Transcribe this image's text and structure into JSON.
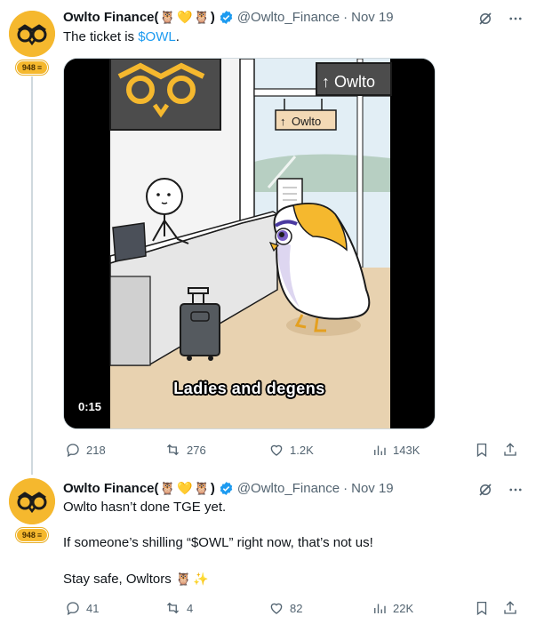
{
  "tweets": [
    {
      "author": {
        "name": "Owlto Finance(",
        "name_close": ")",
        "emojis": [
          "owl-emoji",
          "yellow-heart-emoji",
          "owl-emoji"
        ],
        "handle": "@Owlto_Finance",
        "separator": "·",
        "date": "Nov 19",
        "badge": "948"
      },
      "text_prefix": "The ticket is ",
      "cashtag": "$OWL",
      "text_suffix": ".",
      "media": {
        "sign_text": "Owlto",
        "small_sign_text": "Owlto",
        "caption": "Ladies and degens",
        "duration": "0:15"
      },
      "stats": {
        "replies": "218",
        "reposts": "276",
        "likes": "1.2K",
        "views": "143K"
      }
    },
    {
      "author": {
        "name": "Owlto Finance(",
        "name_close": ")",
        "emojis": [
          "owl-emoji",
          "yellow-heart-emoji",
          "owl-emoji"
        ],
        "handle": "@Owlto_Finance",
        "separator": "·",
        "date": "Nov 19",
        "badge": "948"
      },
      "paragraphs": [
        "Owlto hasn’t done TGE yet.",
        "If someone’s shilling “$OWL” right now, that’s not us!",
        "Stay safe, Owltors"
      ],
      "trailing_emojis": [
        "owl-emoji",
        "sparkles-emoji"
      ],
      "stats": {
        "replies": "41",
        "reposts": "4",
        "likes": "82",
        "views": "22K"
      }
    }
  ],
  "colors": {
    "brand": "#F5B82E",
    "link": "#1d9bf0",
    "muted": "#536471",
    "verified": "#1d9bf0"
  }
}
